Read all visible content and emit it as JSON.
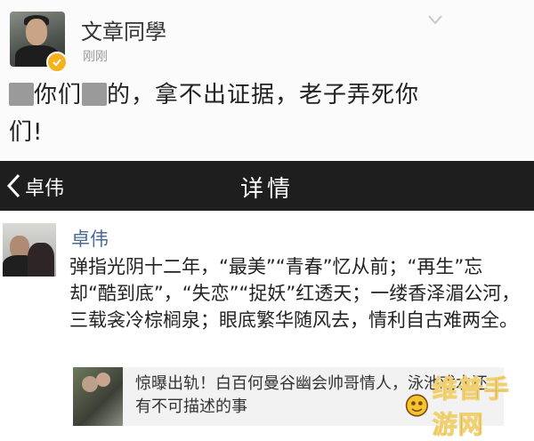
{
  "top_post": {
    "username": "文章同學",
    "time": "刚刚",
    "text": "你们 的，拿不出证据，老子弄死你们!",
    "text_parts": [
      "你们",
      "的，拿不出证据，老子弄死你",
      "们!"
    ]
  },
  "navbar": {
    "back_label": "卓伟",
    "title": "详情"
  },
  "detail_post": {
    "username": "卓伟",
    "text": "弹指光阴十二年，“最美”“青春”忆从前；“再生”忘却“酷到底”，“失恋”“捉妖”红透天；一缕香泽湄公河，三载衾冷棕榈泉；眼底繁华随风去，情利自古难两全。",
    "card_title": "惊曝出轨！白百何曼谷幽会帅哥情人，泳池戏水还有不可描述的事"
  },
  "watermark": {
    "text": "维普手游网"
  },
  "colors": {
    "navbar_bg": "#1e1e1e",
    "username_link": "#4a6a97",
    "badge": "#f5b21f",
    "watermark_text": "#5d3a1a"
  }
}
